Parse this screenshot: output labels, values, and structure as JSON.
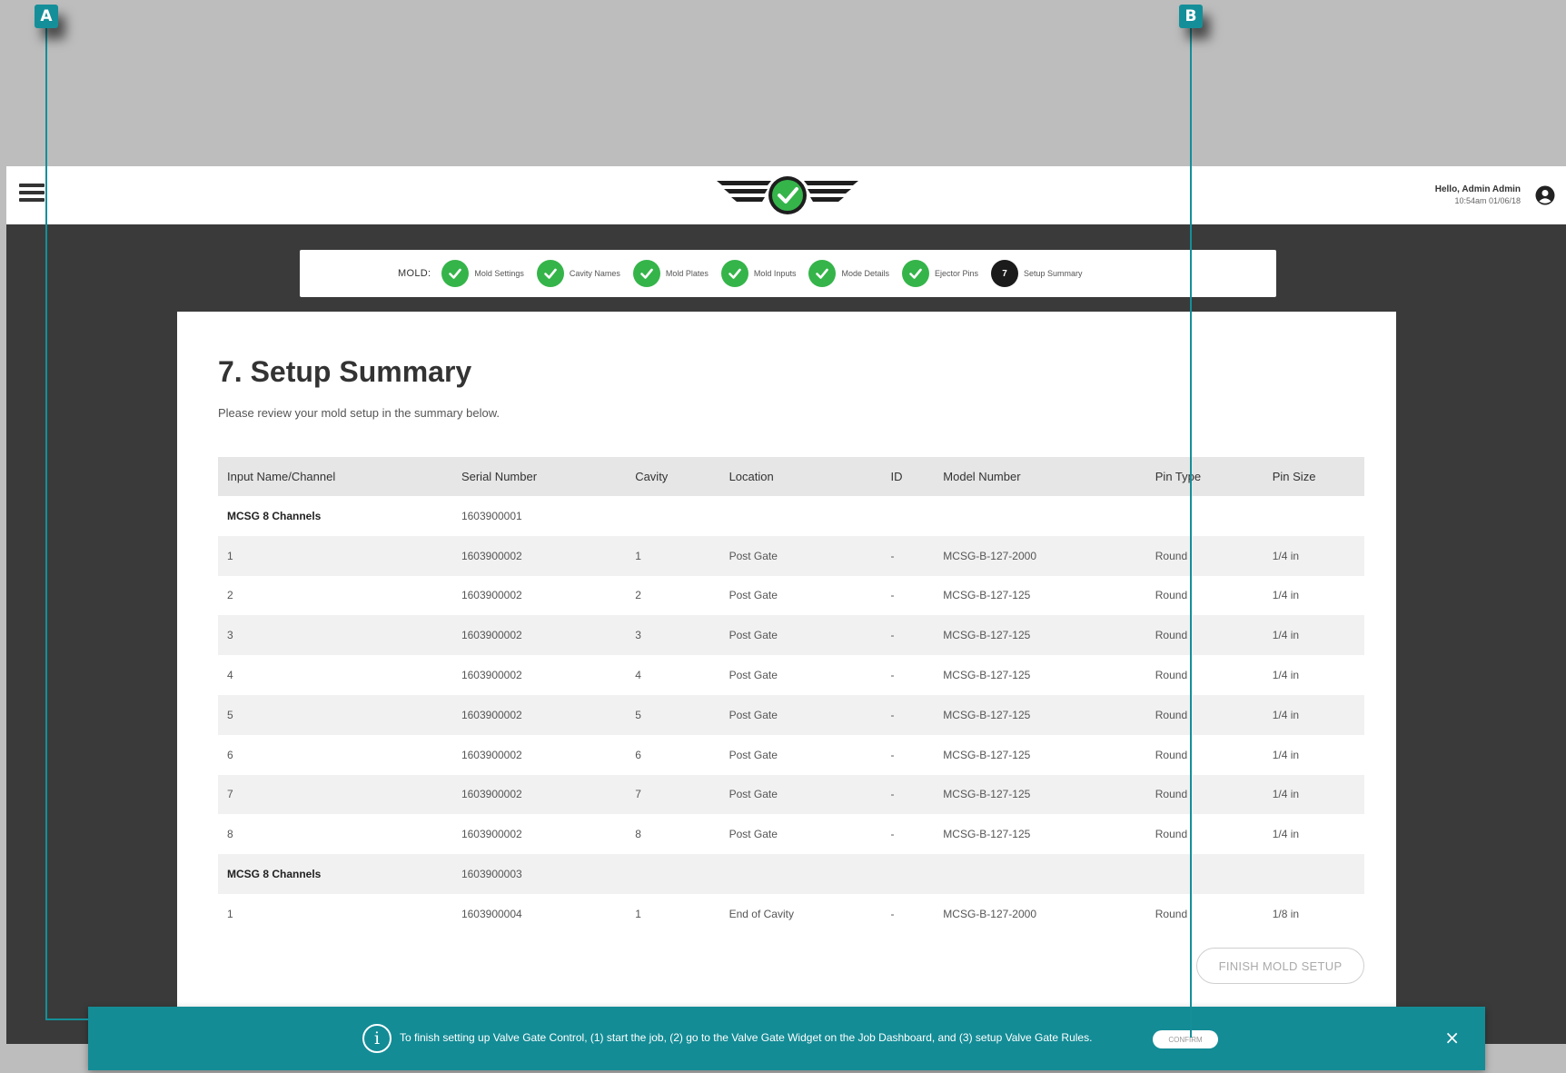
{
  "callouts": {
    "a": "A",
    "b": "B"
  },
  "header": {
    "greeting": "Hello, Admin Admin",
    "timestamp": "10:54am 01/06/18"
  },
  "stepper": {
    "label": "MOLD:",
    "steps": [
      {
        "label": "Mold Settings",
        "status": "complete"
      },
      {
        "label": "Cavity Names",
        "status": "complete"
      },
      {
        "label": "Mold Plates",
        "status": "complete"
      },
      {
        "label": "Mold Inputs",
        "status": "complete"
      },
      {
        "label": "Mode Details",
        "status": "complete"
      },
      {
        "label": "Ejector Pins",
        "status": "complete"
      },
      {
        "label": "Setup Summary",
        "status": "active",
        "number": "7"
      }
    ]
  },
  "main": {
    "title": "7. Setup Summary",
    "subtitle": "Please review your mold setup in the summary below.",
    "table": {
      "headers": [
        "Input Name/Channel",
        "Serial Number",
        "Cavity",
        "Location",
        "ID",
        "Model Number",
        "Pin Type",
        "Pin Size"
      ],
      "rows": [
        [
          "MCSG 8 Channels",
          "1603900001",
          "",
          "",
          "",
          "",
          "",
          ""
        ],
        [
          "1",
          "1603900002",
          "1",
          "Post Gate",
          "-",
          "MCSG-B-127-2000",
          "Round",
          "1/4 in"
        ],
        [
          "2",
          "1603900002",
          "2",
          "Post Gate",
          "-",
          "MCSG-B-127-125",
          "Round",
          "1/4 in"
        ],
        [
          "3",
          "1603900002",
          "3",
          "Post Gate",
          "-",
          "MCSG-B-127-125",
          "Round",
          "1/4 in"
        ],
        [
          "4",
          "1603900002",
          "4",
          "Post Gate",
          "-",
          "MCSG-B-127-125",
          "Round",
          "1/4 in"
        ],
        [
          "5",
          "1603900002",
          "5",
          "Post Gate",
          "-",
          "MCSG-B-127-125",
          "Round",
          "1/4 in"
        ],
        [
          "6",
          "1603900002",
          "6",
          "Post Gate",
          "-",
          "MCSG-B-127-125",
          "Round",
          "1/4 in"
        ],
        [
          "7",
          "1603900002",
          "7",
          "Post Gate",
          "-",
          "MCSG-B-127-125",
          "Round",
          "1/4 in"
        ],
        [
          "8",
          "1603900002",
          "8",
          "Post Gate",
          "-",
          "MCSG-B-127-125",
          "Round",
          "1/4 in"
        ],
        [
          "MCSG 8 Channels",
          "1603900003",
          "",
          "",
          "",
          "",
          "",
          ""
        ],
        [
          "1",
          "1603900004",
          "1",
          "End of Cavity",
          "-",
          "MCSG-B-127-2000",
          "Round",
          "1/8 in"
        ]
      ]
    },
    "finish_label": "FINISH MOLD SETUP"
  },
  "banner": {
    "message": "To finish setting up Valve Gate Control, (1) start the job, (2) go to the Valve Gate Widget on the Job Dashboard, and (3) setup Valve Gate Rules.",
    "confirm_label": "CONFIRM",
    "close_label": "×"
  },
  "colors": {
    "accent": "#138c96",
    "success": "#35b44a",
    "dark_bg": "#3a3a3a"
  },
  "icons": [
    "hamburger-menu-icon",
    "logo-check-icon",
    "account-icon",
    "check-icon",
    "info-icon",
    "close-icon"
  ]
}
